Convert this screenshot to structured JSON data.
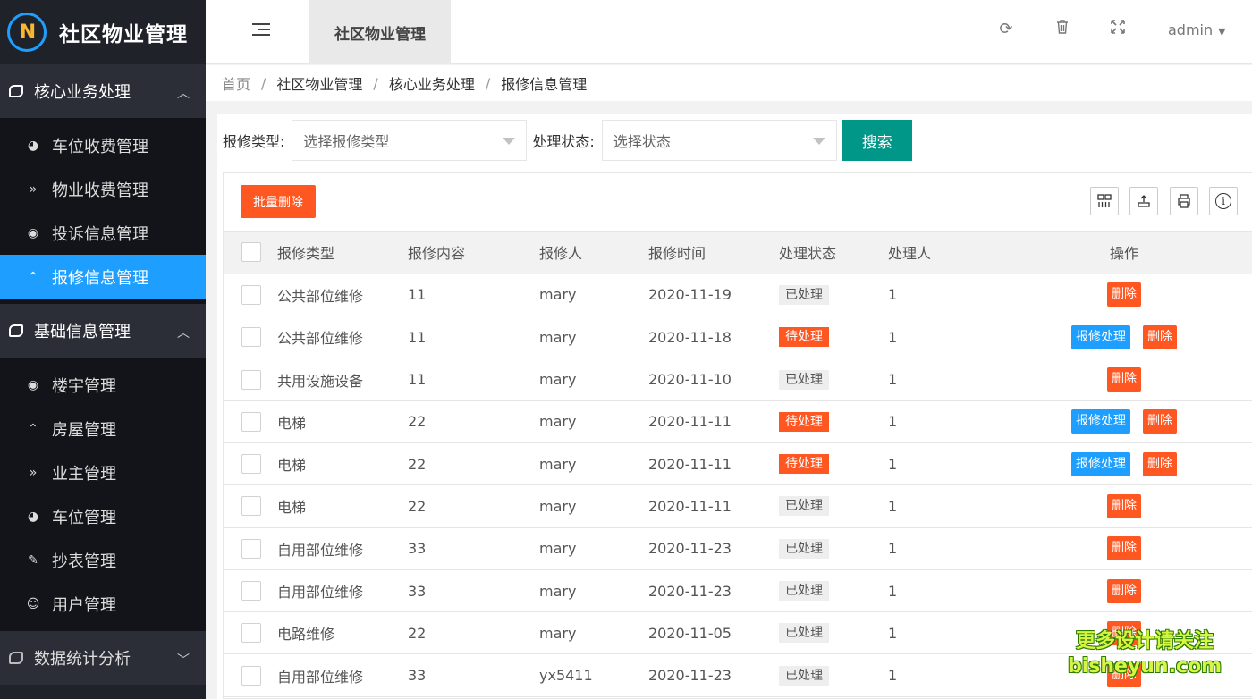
{
  "app": {
    "title": "社区物业管理",
    "logo_letters": "N"
  },
  "sidebar": {
    "groups": [
      {
        "label": "核心业务处理",
        "expanded": true,
        "items": [
          {
            "label": "车位收费管理",
            "icon": "dashboard-icon"
          },
          {
            "label": "物业收费管理",
            "icon": "double-chevron-down-icon"
          },
          {
            "label": "投诉信息管理",
            "icon": "target-icon"
          },
          {
            "label": "报修信息管理",
            "icon": "chevron-up-circle-icon",
            "active": true
          }
        ]
      },
      {
        "label": "基础信息管理",
        "expanded": true,
        "items": [
          {
            "label": "楼宇管理",
            "icon": "target-icon"
          },
          {
            "label": "房屋管理",
            "icon": "chevron-up-circle-icon"
          },
          {
            "label": "业主管理",
            "icon": "double-chevron-down-icon"
          },
          {
            "label": "车位管理",
            "icon": "dashboard-icon"
          },
          {
            "label": "抄表管理",
            "icon": "edit-icon"
          },
          {
            "label": "用户管理",
            "icon": "user-circle-icon"
          }
        ]
      },
      {
        "label": "数据统计分析",
        "expanded": false,
        "items": []
      }
    ]
  },
  "header": {
    "tab_label": "社区物业管理",
    "user": "admin",
    "icons": [
      "refresh-icon",
      "trash-icon",
      "fullscreen-icon"
    ]
  },
  "breadcrumb": [
    "首页",
    "社区物业管理",
    "核心业务处理",
    "报修信息管理"
  ],
  "filters": {
    "type_label": "报修类型:",
    "type_placeholder": "选择报修类型",
    "status_label": "处理状态:",
    "status_placeholder": "选择状态",
    "search_label": "搜索"
  },
  "toolbar": {
    "batch_delete_label": "批量删除",
    "tools": [
      "columns-icon",
      "export-icon",
      "print-icon",
      "info-icon"
    ]
  },
  "table": {
    "columns": [
      "报修类型",
      "报修内容",
      "报修人",
      "报修时间",
      "处理状态",
      "处理人",
      "操作"
    ],
    "rows": [
      {
        "type": "公共部位维修",
        "content": "11",
        "reporter": "mary",
        "time": "2020-11-19",
        "status": "已处理",
        "handler": "1"
      },
      {
        "type": "公共部位维修",
        "content": "11",
        "reporter": "mary",
        "time": "2020-11-18",
        "status": "待处理",
        "handler": "1"
      },
      {
        "type": "共用设施设备",
        "content": "11",
        "reporter": "mary",
        "time": "2020-11-10",
        "status": "已处理",
        "handler": "1"
      },
      {
        "type": "电梯",
        "content": "22",
        "reporter": "mary",
        "time": "2020-11-11",
        "status": "待处理",
        "handler": "1"
      },
      {
        "type": "电梯",
        "content": "22",
        "reporter": "mary",
        "time": "2020-11-11",
        "status": "待处理",
        "handler": "1"
      },
      {
        "type": "电梯",
        "content": "22",
        "reporter": "mary",
        "time": "2020-11-11",
        "status": "已处理",
        "handler": "1"
      },
      {
        "type": "自用部位维修",
        "content": "33",
        "reporter": "mary",
        "time": "2020-11-23",
        "status": "已处理",
        "handler": "1"
      },
      {
        "type": "自用部位维修",
        "content": "33",
        "reporter": "mary",
        "time": "2020-11-23",
        "status": "已处理",
        "handler": "1"
      },
      {
        "type": "电路维修",
        "content": "22",
        "reporter": "mary",
        "time": "2020-11-05",
        "status": "已处理",
        "handler": "1"
      },
      {
        "type": "自用部位维修",
        "content": "33",
        "reporter": "yx5411",
        "time": "2020-11-23",
        "status": "已处理",
        "handler": "1"
      }
    ],
    "status_done": "已处理",
    "status_pending": "待处理",
    "handle_label": "报修处理",
    "delete_label": "删除"
  },
  "watermark": {
    "line1": "更多设计请关注",
    "line2": "bisheyun.com"
  },
  "colors": {
    "accent": "#1e9fff",
    "danger": "#ff5722",
    "primary": "#009688",
    "sidebar": "#20222a"
  }
}
